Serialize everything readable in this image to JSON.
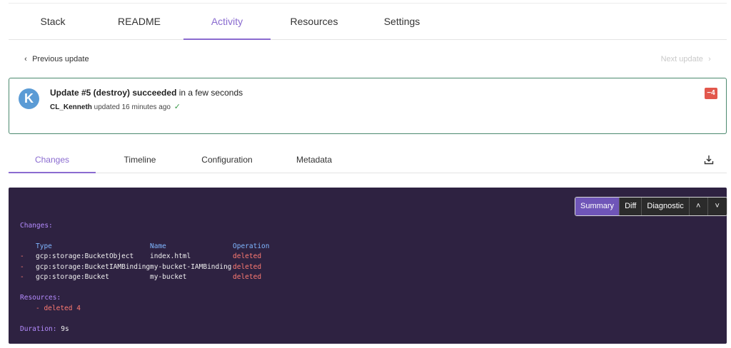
{
  "tabs": [
    {
      "label": "Stack"
    },
    {
      "label": "README"
    },
    {
      "label": "Activity"
    },
    {
      "label": "Resources"
    },
    {
      "label": "Settings"
    }
  ],
  "nav": {
    "previous_label": "Previous update",
    "next_label": "Next update"
  },
  "update": {
    "avatar_letter": "K",
    "title_bold": "Update #5 (destroy) succeeded",
    "title_rest": " in a few seconds",
    "user": "CL_Kenneth",
    "sub_rest": " updated 16 minutes ago",
    "badge": "−4"
  },
  "subtabs": [
    {
      "label": "Changes"
    },
    {
      "label": "Timeline"
    },
    {
      "label": "Configuration"
    },
    {
      "label": "Metadata"
    }
  ],
  "toolbar": {
    "summary": "Summary",
    "diff": "Diff",
    "diagnostic": "Diagnostic",
    "up": "˄",
    "down": "˅"
  },
  "console": {
    "changes_heading": "Changes:",
    "col_type": "Type",
    "col_name": "Name",
    "col_operation": "Operation",
    "rows": [
      {
        "sign": "-",
        "type": "gcp:storage:BucketObject",
        "name": "index.html",
        "op": "deleted"
      },
      {
        "sign": "-",
        "type": "gcp:storage:BucketIAMBinding",
        "name": "my-bucket-IAMBinding",
        "op": "deleted"
      },
      {
        "sign": "-",
        "type": "gcp:storage:Bucket",
        "name": "my-bucket",
        "op": "deleted"
      }
    ],
    "resources_heading": "Resources:",
    "resources_line": "- deleted 4",
    "duration_label": "Duration:",
    "duration_value": "9s"
  },
  "colors": {
    "accent": "#8a6bd0",
    "console_bg": "#2e2241",
    "card_border": "#4c8a6f",
    "badge": "#e2574c"
  }
}
